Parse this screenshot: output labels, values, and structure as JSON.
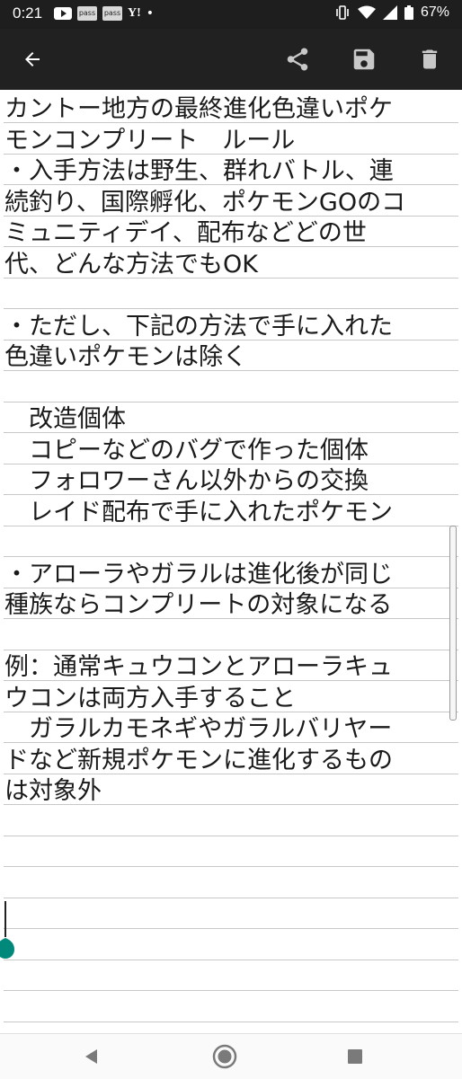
{
  "status_bar": {
    "time": "0:21",
    "left_icons": [
      "youtube-icon",
      "pass-icon",
      "pass-icon",
      "yahoo-icon"
    ],
    "pass_label": "pass",
    "yahoo_label": "Y!",
    "dot": "•",
    "battery": "67%"
  },
  "app_bar": {
    "icons": [
      "back-arrow-icon",
      "share-icon",
      "save-icon",
      "trash-icon"
    ]
  },
  "editor": {
    "lines": [
      "カントー地方の最終進化色違いポケ",
      "モンコンプリート　ルール",
      "・入手方法は野生、群れバトル、連",
      "続釣り、国際孵化、ポケモンGOのコ",
      "ミュニティデイ、配布などどの世",
      "代、どんな方法でもOK",
      "",
      "・ただし、下記の方法で手に入れた",
      "色違いポケモンは除く",
      "",
      "　改造個体",
      "　コピーなどのバグで作った個体",
      "　フォロワーさん以外からの交換",
      "　レイド配布で手に入れたポケモン",
      "",
      "・アローラやガラルは進化後が同じ",
      "種族ならコンプリートの対象になる",
      "",
      "例：通常キュウコンとアローラキュ",
      "ウコンは両方入手すること",
      "　ガラルカモネギやガラルバリヤー",
      "ドなど新規ポケモンに進化するもの",
      "は対象外"
    ]
  },
  "colors": {
    "status_bar_bg": "#1e1e1e",
    "app_bar_bg": "#212121",
    "rule_line": "#c8c8c8",
    "cursor_handle": "#00897b"
  },
  "nav_bar": {
    "icons": [
      "back-triangle-icon",
      "home-circle-icon",
      "recents-square-icon"
    ]
  }
}
